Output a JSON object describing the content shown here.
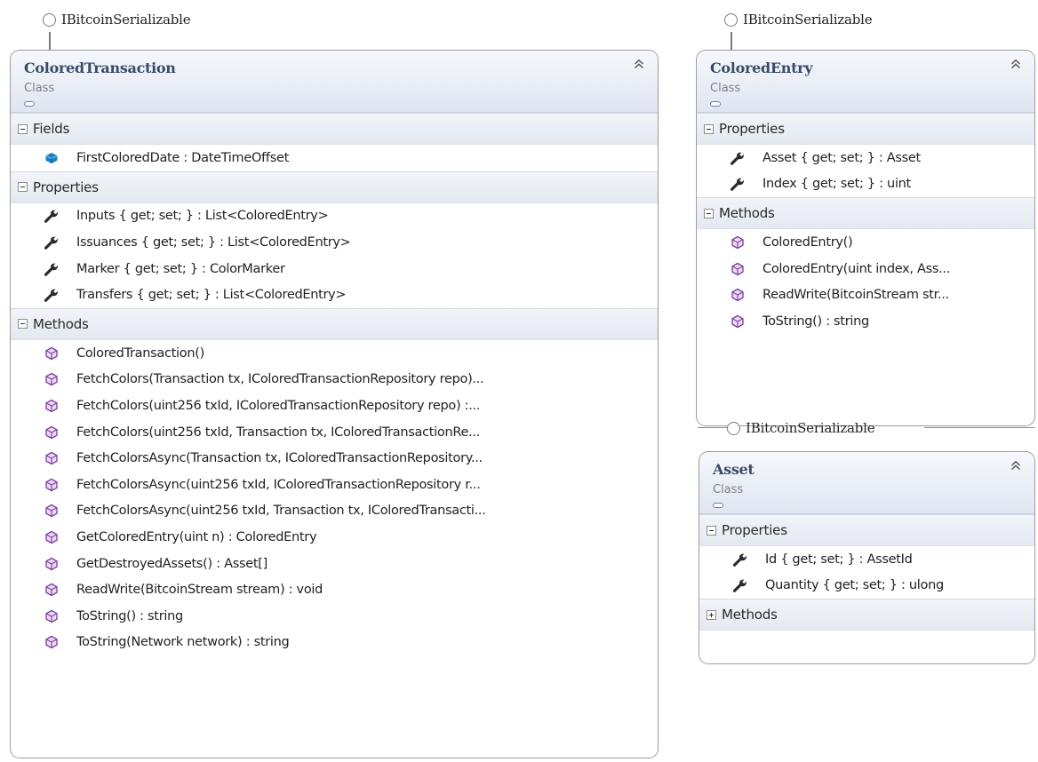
{
  "interface_label": "IBitcoinSerializable",
  "classes": {
    "colored_transaction": {
      "name": "ColoredTransaction",
      "stereotype": "Class",
      "sections": {
        "fields": {
          "title": "Fields",
          "items": [
            "FirstColoredDate : DateTimeOffset"
          ]
        },
        "properties": {
          "title": "Properties",
          "items": [
            "Inputs { get; set; } : List<ColoredEntry>",
            "Issuances { get; set; } : List<ColoredEntry>",
            "Marker { get; set; } : ColorMarker",
            "Transfers { get; set; } : List<ColoredEntry>"
          ]
        },
        "methods": {
          "title": "Methods",
          "items": [
            "ColoredTransaction()",
            "FetchColors(Transaction tx, IColoredTransactionRepository repo)...",
            "FetchColors(uint256 txId, IColoredTransactionRepository repo) :...",
            "FetchColors(uint256 txId, Transaction tx, IColoredTransactionRe...",
            "FetchColorsAsync(Transaction tx, IColoredTransactionRepository...",
            "FetchColorsAsync(uint256 txId, IColoredTransactionRepository r...",
            "FetchColorsAsync(uint256 txId, Transaction tx, IColoredTransacti...",
            "GetColoredEntry(uint n) : ColoredEntry",
            "GetDestroyedAssets() : Asset[]",
            "ReadWrite(BitcoinStream stream) : void",
            "ToString() : string",
            "ToString(Network network) : string"
          ]
        }
      }
    },
    "colored_entry": {
      "name": "ColoredEntry",
      "stereotype": "Class",
      "sections": {
        "properties": {
          "title": "Properties",
          "items": [
            "Asset { get; set; } : Asset",
            "Index { get; set; } : uint"
          ]
        },
        "methods": {
          "title": "Methods",
          "items": [
            "ColoredEntry()",
            "ColoredEntry(uint index, Ass...",
            "ReadWrite(BitcoinStream str...",
            "ToString() : string"
          ]
        }
      }
    },
    "asset": {
      "name": "Asset",
      "stereotype": "Class",
      "sections": {
        "properties": {
          "title": "Properties",
          "items": [
            "Id { get; set; } : AssetId",
            "Quantity { get; set; } : ulong"
          ]
        },
        "methods": {
          "title": "Methods",
          "items": []
        }
      }
    }
  }
}
